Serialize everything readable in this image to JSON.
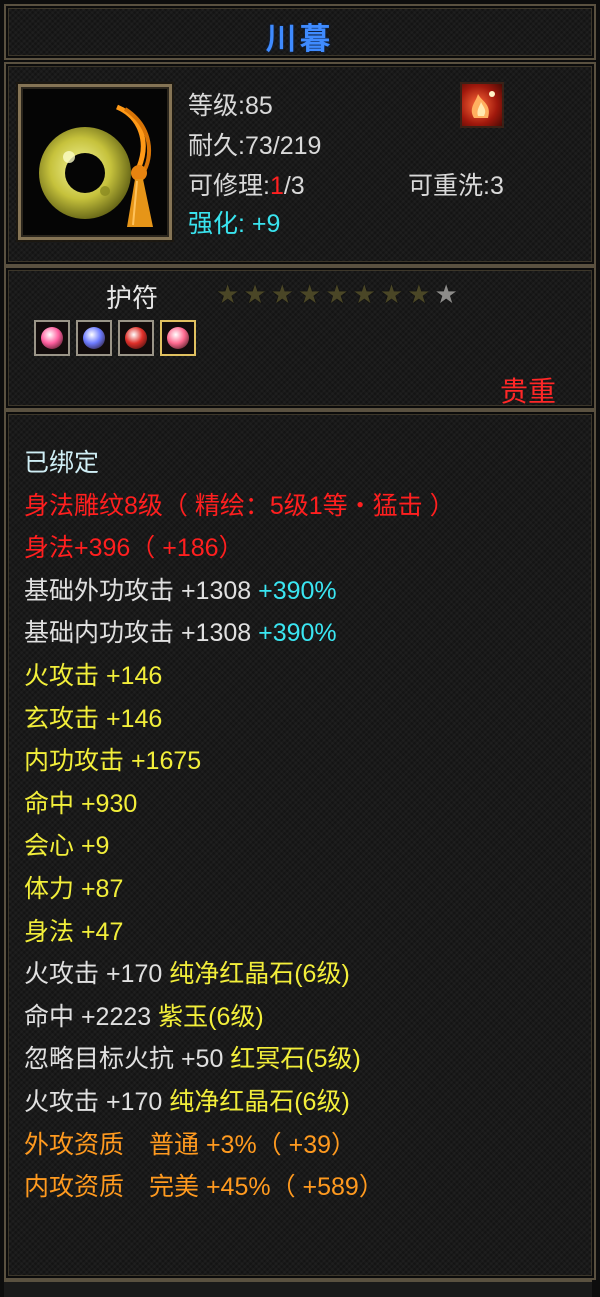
{
  "title": "川暮",
  "item": {
    "level_label": "等级:",
    "level_value": "85",
    "durability_label": "耐久:",
    "durability_value": "73/219",
    "repair_label": "可修理:",
    "repair_current": "1",
    "repair_max": "/3",
    "rewash_label": "可重洗:",
    "rewash_value": "3",
    "enhance_label": "强化:",
    "enhance_value": "+9"
  },
  "slot_type": "护符",
  "stars": {
    "total": 9,
    "lit": 1
  },
  "gems": [
    {
      "name": "pink-gem-icon",
      "color": "#ff5fa0"
    },
    {
      "name": "blue-gem-icon",
      "color": "#6d7bff"
    },
    {
      "name": "red-gem-icon",
      "color": "#e0302a"
    },
    {
      "name": "pink-gem-icon",
      "color": "#ff6a90"
    }
  ],
  "rarity": "贵重",
  "attributes": [
    {
      "text": "已绑定",
      "color": "#cfeef5"
    },
    {
      "text": "身法雕纹8级（ 精绘：5级1等・猛击 ）",
      "color": "#ff1f1f"
    },
    {
      "text": "身法+396（ +186）",
      "color": "#ff1f1f"
    },
    {
      "text": "基础外功攻击 +1308",
      "extra": " +390%",
      "color": "#e0e0e0",
      "extra_color": "#3ae6f2"
    },
    {
      "text": "基础内功攻击 +1308",
      "extra": " +390%",
      "color": "#e0e0e0",
      "extra_color": "#3ae6f2"
    },
    {
      "text": "火攻击 +146",
      "color": "#f2ee3a"
    },
    {
      "text": "玄攻击 +146",
      "color": "#f2ee3a"
    },
    {
      "text": "内功攻击 +1675",
      "color": "#f2ee3a"
    },
    {
      "text": "命中 +930",
      "color": "#f2ee3a"
    },
    {
      "text": "会心 +9",
      "color": "#f2ee3a"
    },
    {
      "text": "体力 +87",
      "color": "#f2ee3a"
    },
    {
      "text": "身法 +47",
      "color": "#f2ee3a"
    },
    {
      "text": "火攻击 +170",
      "extra": " 纯净红晶石(6级)",
      "color": "#e0e0e0",
      "extra_color": "#f2ee3a"
    },
    {
      "text": "命中 +2223",
      "extra": " 紫玉(6级)",
      "color": "#e0e0e0",
      "extra_color": "#f2ee3a"
    },
    {
      "text": "忽略目标火抗 +50",
      "extra": " 红冥石(5级)",
      "color": "#e0e0e0",
      "extra_color": "#f2ee3a"
    },
    {
      "text": "火攻击 +170",
      "extra": " 纯净红晶石(6级)",
      "color": "#e0e0e0",
      "extra_color": "#f2ee3a"
    },
    {
      "text": "外攻资质　普通 +3%（ +39）",
      "color": "#ff9a1f"
    },
    {
      "text": "内攻资质　完美 +45%（ +589）",
      "color": "#ff9a1f"
    }
  ]
}
